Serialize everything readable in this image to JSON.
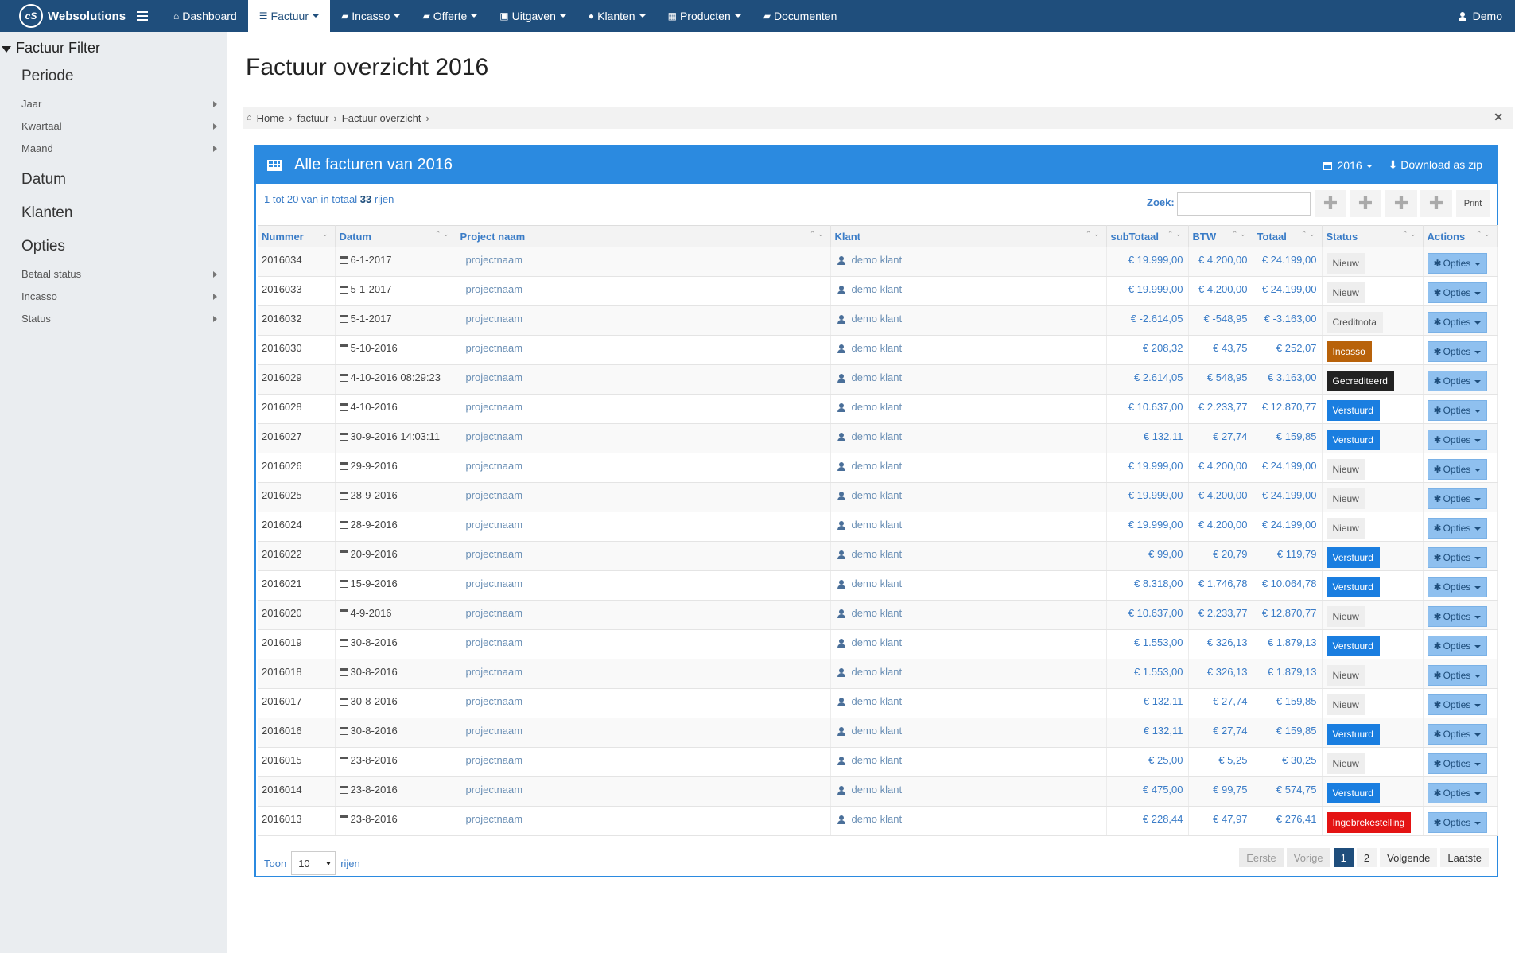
{
  "nav": {
    "brand": "Websolutions",
    "logo_text": "cS",
    "items": [
      {
        "label": "Dashboard",
        "icon": "home-icon",
        "caret": false,
        "active": false
      },
      {
        "label": "Factuur",
        "icon": "list-icon",
        "caret": true,
        "active": true
      },
      {
        "label": "Incasso",
        "icon": "book-icon",
        "caret": true,
        "active": false
      },
      {
        "label": "Offerte",
        "icon": "book-icon",
        "caret": true,
        "active": false
      },
      {
        "label": "Uitgaven",
        "icon": "briefcase-icon",
        "caret": true,
        "active": false
      },
      {
        "label": "Klanten",
        "icon": "user-icon",
        "caret": true,
        "active": false
      },
      {
        "label": "Producten",
        "icon": "table-icon",
        "caret": true,
        "active": false
      },
      {
        "label": "Documenten",
        "icon": "book-icon",
        "caret": false,
        "active": false
      }
    ],
    "user": "Demo"
  },
  "sidebar": {
    "title": "Factuur Filter",
    "sections": [
      {
        "label": "Periode",
        "items": [
          "Jaar",
          "Kwartaal",
          "Maand"
        ]
      },
      {
        "label": "Datum",
        "items": []
      },
      {
        "label": "Klanten",
        "items": []
      },
      {
        "label": "Opties",
        "items": [
          "Betaal status",
          "Incasso",
          "Status"
        ]
      }
    ]
  },
  "page": {
    "title": "Factuur overzicht  2016"
  },
  "breadcrumb": [
    "Home",
    "factuur",
    "Factuur overzicht"
  ],
  "panel": {
    "title": "Alle facturen van 2016",
    "year_dropdown": "2016",
    "download_label": "Download as zip",
    "info_prefix": "1 tot 20 van in totaal",
    "info_total": "33",
    "info_suffix": "rijen",
    "search_label": "Zoek:",
    "search_value": "",
    "print_label": "Print"
  },
  "table": {
    "columns": [
      "Nummer",
      "Datum",
      "Project naam",
      "Klant",
      "subTotaal",
      "BTW",
      "Totaal",
      "Status",
      "Actions"
    ],
    "options_label": "Opties",
    "rows": [
      [
        "2016034",
        "6-1-2017",
        "projectnaam",
        "demo klant",
        "€ 19.999,00",
        "€ 4.200,00",
        "€ 24.199,00",
        "Nieuw"
      ],
      [
        "2016033",
        "5-1-2017",
        "projectnaam",
        "demo klant",
        "€ 19.999,00",
        "€ 4.200,00",
        "€ 24.199,00",
        "Nieuw"
      ],
      [
        "2016032",
        "5-1-2017",
        "projectnaam",
        "demo klant",
        "€ -2.614,05",
        "€ -548,95",
        "€ -3.163,00",
        "Creditnota"
      ],
      [
        "2016030",
        "5-10-2016",
        "projectnaam",
        "demo klant",
        "€ 208,32",
        "€ 43,75",
        "€ 252,07",
        "Incasso"
      ],
      [
        "2016029",
        "4-10-2016 08:29:23",
        "projectnaam",
        "demo klant",
        "€ 2.614,05",
        "€ 548,95",
        "€ 3.163,00",
        "Gecrediteerd"
      ],
      [
        "2016028",
        "4-10-2016",
        "projectnaam",
        "demo klant",
        "€ 10.637,00",
        "€ 2.233,77",
        "€ 12.870,77",
        "Verstuurd"
      ],
      [
        "2016027",
        "30-9-2016 14:03:11",
        "projectnaam",
        "demo klant",
        "€ 132,11",
        "€ 27,74",
        "€ 159,85",
        "Verstuurd"
      ],
      [
        "2016026",
        "29-9-2016",
        "projectnaam",
        "demo klant",
        "€ 19.999,00",
        "€ 4.200,00",
        "€ 24.199,00",
        "Nieuw"
      ],
      [
        "2016025",
        "28-9-2016",
        "projectnaam",
        "demo klant",
        "€ 19.999,00",
        "€ 4.200,00",
        "€ 24.199,00",
        "Nieuw"
      ],
      [
        "2016024",
        "28-9-2016",
        "projectnaam",
        "demo klant",
        "€ 19.999,00",
        "€ 4.200,00",
        "€ 24.199,00",
        "Nieuw"
      ],
      [
        "2016022",
        "20-9-2016",
        "projectnaam",
        "demo klant",
        "€ 99,00",
        "€ 20,79",
        "€ 119,79",
        "Verstuurd"
      ],
      [
        "2016021",
        "15-9-2016",
        "projectnaam",
        "demo klant",
        "€ 8.318,00",
        "€ 1.746,78",
        "€ 10.064,78",
        "Verstuurd"
      ],
      [
        "2016020",
        "4-9-2016",
        "projectnaam",
        "demo klant",
        "€ 10.637,00",
        "€ 2.233,77",
        "€ 12.870,77",
        "Nieuw"
      ],
      [
        "2016019",
        "30-8-2016",
        "projectnaam",
        "demo klant",
        "€ 1.553,00",
        "€ 326,13",
        "€ 1.879,13",
        "Verstuurd"
      ],
      [
        "2016018",
        "30-8-2016",
        "projectnaam",
        "demo klant",
        "€ 1.553,00",
        "€ 326,13",
        "€ 1.879,13",
        "Nieuw"
      ],
      [
        "2016017",
        "30-8-2016",
        "projectnaam",
        "demo klant",
        "€ 132,11",
        "€ 27,74",
        "€ 159,85",
        "Nieuw"
      ],
      [
        "2016016",
        "30-8-2016",
        "projectnaam",
        "demo klant",
        "€ 132,11",
        "€ 27,74",
        "€ 159,85",
        "Verstuurd"
      ],
      [
        "2016015",
        "23-8-2016",
        "projectnaam",
        "demo klant",
        "€ 25,00",
        "€ 5,25",
        "€ 30,25",
        "Nieuw"
      ],
      [
        "2016014",
        "23-8-2016",
        "projectnaam",
        "demo klant",
        "€ 475,00",
        "€ 99,75",
        "€ 574,75",
        "Verstuurd"
      ],
      [
        "2016013",
        "23-8-2016",
        "projectnaam",
        "demo klant",
        "€ 228,44",
        "€ 47,97",
        "€ 276,41",
        "Ingebrekestelling"
      ]
    ]
  },
  "footer": {
    "show_label": "Toon",
    "page_size": "10",
    "rows_label": "rijen",
    "pager": [
      {
        "label": "Eerste",
        "state": "disabled"
      },
      {
        "label": "Vorige",
        "state": "disabled"
      },
      {
        "label": "1",
        "state": "current"
      },
      {
        "label": "2",
        "state": "normal"
      },
      {
        "label": "Volgende",
        "state": "normal"
      },
      {
        "label": "Laatste",
        "state": "normal"
      }
    ]
  },
  "colors": {
    "navbar": "#1f4e7c",
    "panel_accent": "#2b8ae0",
    "status_verstuurd": "#1a7ee0",
    "status_incasso": "#b8620a",
    "status_gecrediteerd": "#222222",
    "status_ingebrekestelling": "#e41313"
  }
}
